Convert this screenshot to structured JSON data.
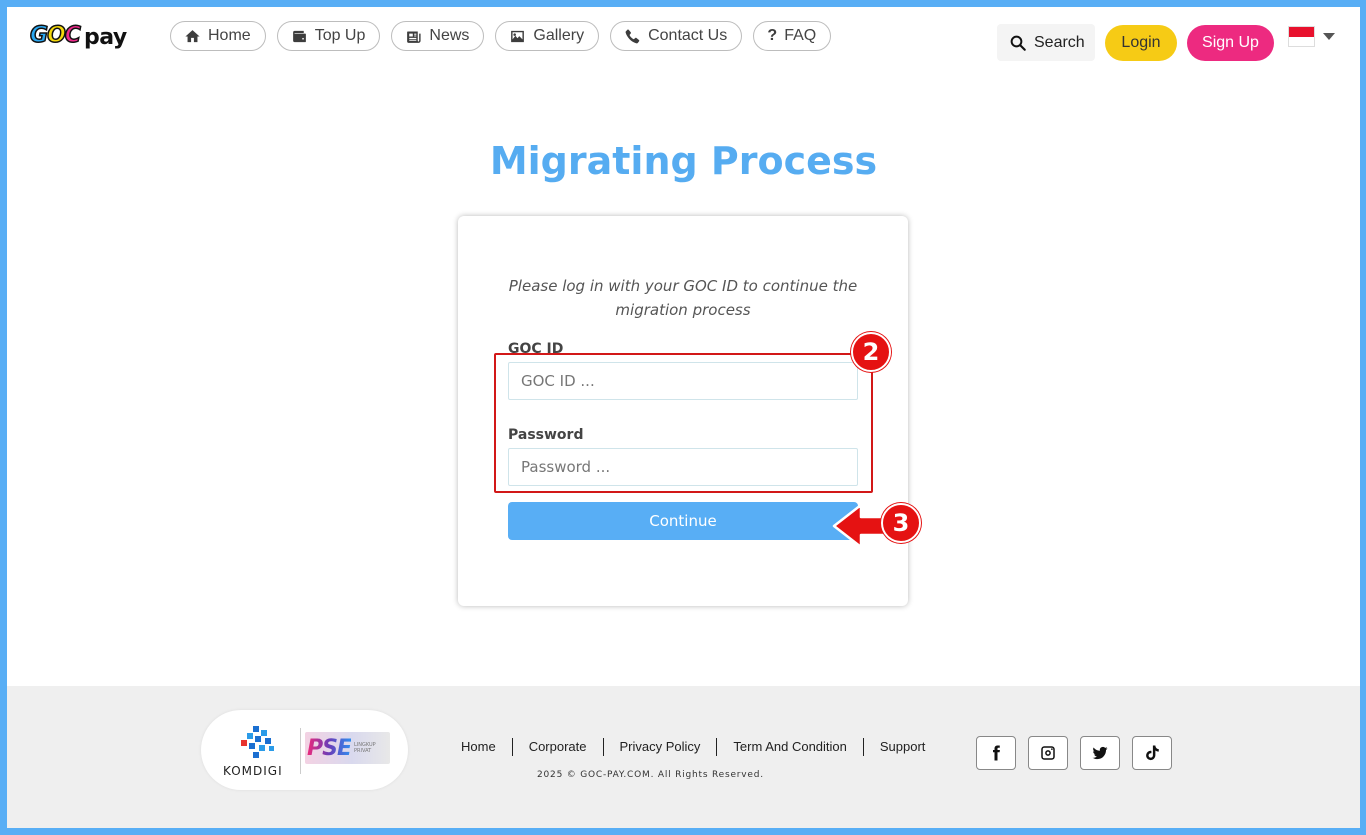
{
  "brand": {
    "logo_goc": "GOC",
    "logo_pay": "pay"
  },
  "nav": {
    "items": [
      {
        "label": "Home",
        "icon": "home-icon"
      },
      {
        "label": "Top Up",
        "icon": "wallet-icon"
      },
      {
        "label": "News",
        "icon": "newspaper-icon"
      },
      {
        "label": "Gallery",
        "icon": "image-icon"
      },
      {
        "label": "Contact Us",
        "icon": "phone-icon"
      },
      {
        "label": "FAQ",
        "icon": "question-icon"
      }
    ]
  },
  "header": {
    "search_label": "Search",
    "login_label": "Login",
    "signup_label": "Sign Up",
    "language_flag": "indonesia-flag"
  },
  "main": {
    "title": "Migrating Process",
    "intro_text": "Please log in with your GOC ID to continue the migration process",
    "goc_id_label": "GOC ID",
    "goc_id_placeholder": "GOC ID ...",
    "goc_id_value": "",
    "password_label": "Password",
    "password_placeholder": "Password ...",
    "password_value": "",
    "continue_label": "Continue"
  },
  "annotations": {
    "step_fields": "2",
    "step_continue": "3"
  },
  "footer": {
    "komdigi_text": "KOMDIGI",
    "pse_text": "PSE",
    "pse_subtext": "LINGKUP PRIVAT",
    "links": [
      "Home",
      "Corporate",
      "Privacy Policy",
      "Term And Condition",
      "Support"
    ],
    "copyright": "2025 © GOC-PAY.COM. All Rights Reserved.",
    "social": [
      "facebook-icon",
      "instagram-icon",
      "twitter-icon",
      "tiktok-icon"
    ]
  },
  "colors": {
    "accent": "#58aef5",
    "login": "#f6cb15",
    "signup": "#ed2a80",
    "annotation": "#e51212"
  }
}
